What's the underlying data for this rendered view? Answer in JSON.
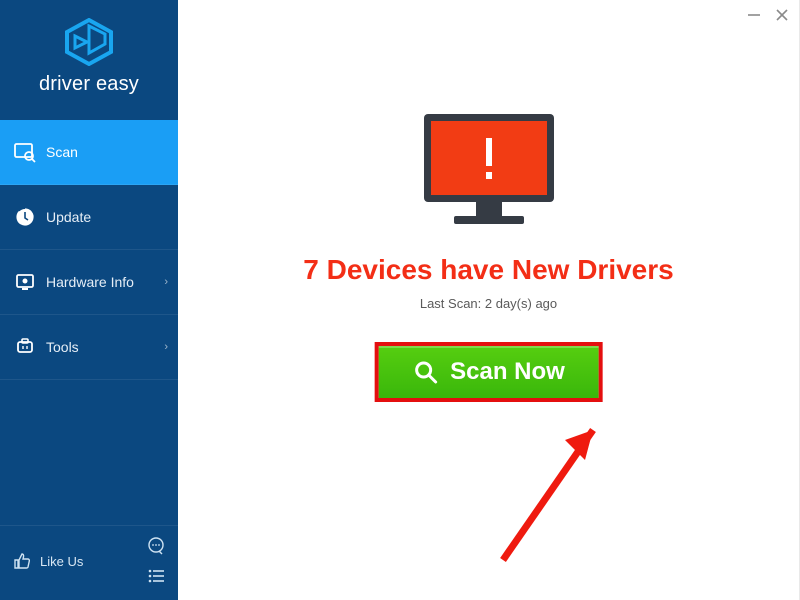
{
  "brand": {
    "name": "driver easy",
    "version": ""
  },
  "nav": {
    "scan": "Scan",
    "update": "Update",
    "hardware_info": "Hardware Info",
    "tools": "Tools"
  },
  "footer": {
    "like_us": "Like Us"
  },
  "main": {
    "headline": "7 Devices have New Drivers",
    "last_scan": "Last Scan: 2 day(s) ago",
    "scan_button": "Scan Now"
  },
  "colors": {
    "sidebar": "#0b4880",
    "accent": "#1a9ef5",
    "alert_red": "#f32e16",
    "button_green": "#3ab70b"
  }
}
